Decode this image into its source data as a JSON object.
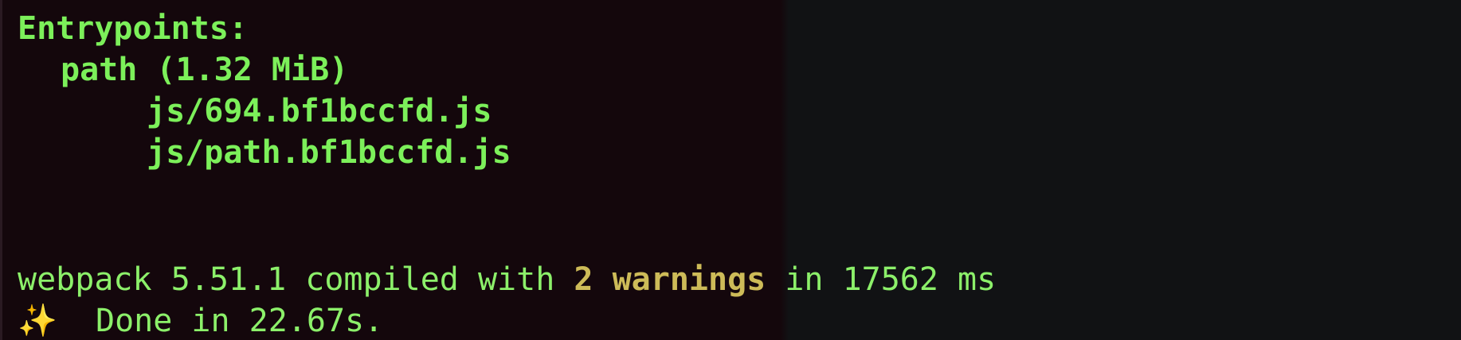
{
  "terminal": {
    "colors": {
      "background_left": "#14070c",
      "background_right": "#111214",
      "text_green": "#7cf05a",
      "text_yellow": "#cdbb58",
      "sparkle": "#f4d45a"
    },
    "entrypoints_heading": "Entrypoints:",
    "entry_name": "path (1.32 MiB)",
    "files": [
      "js/694.bf1bccfd.js",
      "js/path.bf1bccfd.js"
    ],
    "compile_prefix": "webpack 5.51.1 compiled with ",
    "warning_count": "2",
    "warning_word": "warnings",
    "compile_suffix": " in 17562 ms",
    "done_icon": "sparkles-icon",
    "done_text": "Done in 22.67s."
  }
}
